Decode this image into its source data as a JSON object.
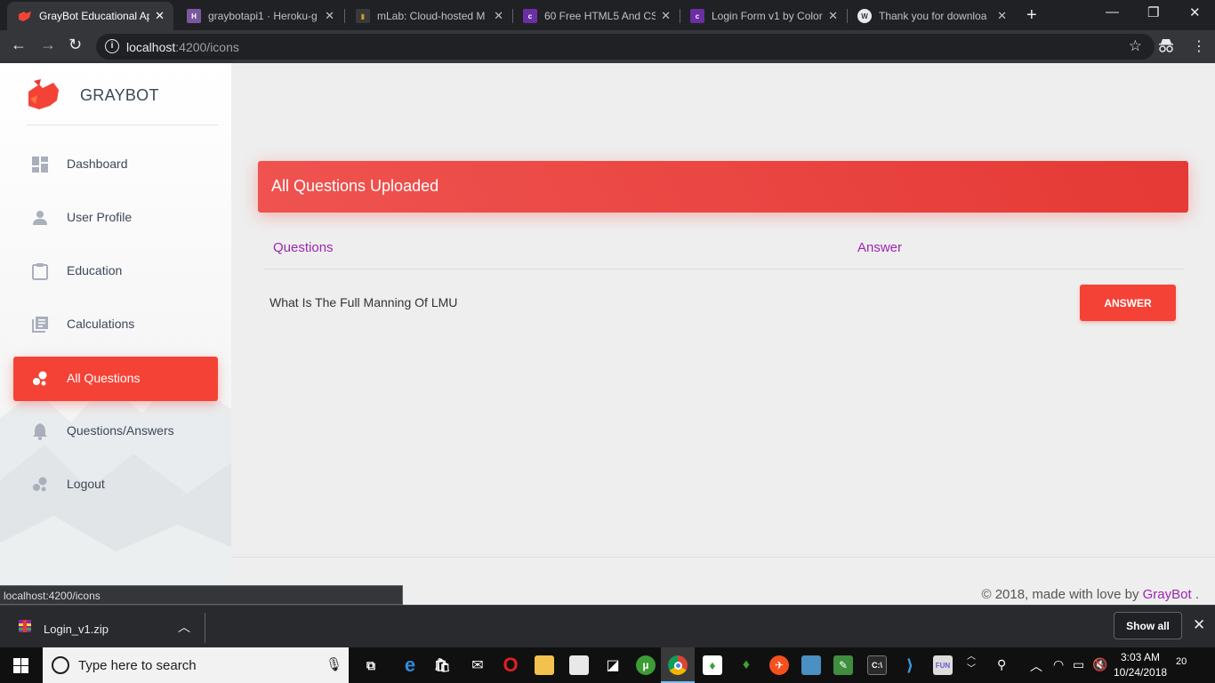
{
  "browser": {
    "tabs": [
      {
        "title": "GrayBot Educational Ap",
        "active": true,
        "favicon_color": "#f44336"
      },
      {
        "title": "graybotapi1 · Heroku-g",
        "active": false,
        "favicon_color": "#79589f"
      },
      {
        "title": "mLab: Cloud-hosted M",
        "active": false,
        "favicon_color": "#c9a227"
      },
      {
        "title": "60 Free HTML5 And CS",
        "active": false,
        "favicon_color": "#6b2fa3"
      },
      {
        "title": "Login Form v1 by Color",
        "active": false,
        "favicon_color": "#6b2fa3"
      },
      {
        "title": "Thank you for downloa",
        "active": false,
        "favicon_color": "#e8eaed"
      }
    ],
    "close_glyph": "✕",
    "new_tab_glyph": "+",
    "url_host": "localhost",
    "url_rest": ":4200/icons"
  },
  "sidebar": {
    "brand": "GRAYBOT",
    "items": [
      {
        "label": "Dashboard",
        "icon": "dashboard-icon",
        "active": false
      },
      {
        "label": "User Profile",
        "icon": "person-icon",
        "active": false
      },
      {
        "label": "Education",
        "icon": "clipboard-icon",
        "active": false
      },
      {
        "label": "Calculations",
        "icon": "library-books-icon",
        "active": false
      },
      {
        "label": "All Questions",
        "icon": "bubble-chart-icon",
        "active": true
      },
      {
        "label": "Questions/Answers",
        "icon": "notifications-icon",
        "active": false
      },
      {
        "label": "Logout",
        "icon": "bubble-chart-icon",
        "active": false
      }
    ]
  },
  "main": {
    "card_title": "All Questions Uploaded",
    "table": {
      "headers": [
        "Questions",
        "Answer"
      ],
      "rows": [
        {
          "question": "What Is The Full Manning Of LMU",
          "action": "ANSWER"
        }
      ]
    },
    "footer": {
      "prefix": "© 2018, made with love by ",
      "brand": "GrayBot",
      "suffix": " ."
    }
  },
  "status_bubble": "localhost:4200/icons",
  "downloads": {
    "file": "Login_v1.zip",
    "show_all": "Show all"
  },
  "taskbar": {
    "search_placeholder": "Type here to search",
    "time": "3:03 AM",
    "date": "10/24/2018",
    "notification_count": "20"
  },
  "colors": {
    "accent": "#f44336",
    "link": "#9c27b0",
    "sidebar_text": "#3c4858",
    "sidebar_icon": "#a9afbb"
  }
}
